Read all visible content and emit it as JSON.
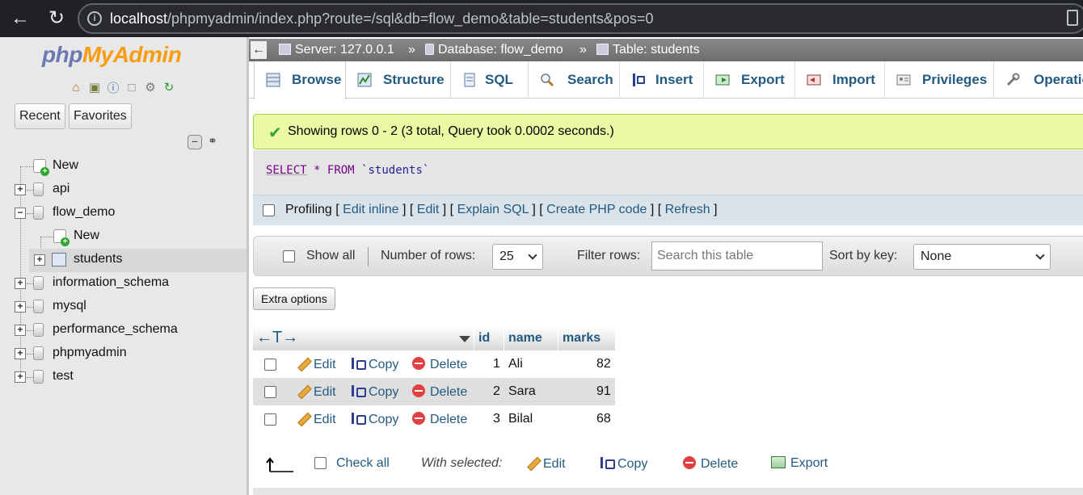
{
  "browser": {
    "url_host": "localhost",
    "url_path": "/phpmyadmin/index.php?route=/sql&db=flow_demo&table=students&pos=0"
  },
  "nav": {
    "logo_php": "php",
    "logo_myadmin": "MyAdmin",
    "recent_label": "Recent",
    "favorites_label": "Favorites",
    "tree": [
      {
        "label": "New",
        "type": "new",
        "level": 0
      },
      {
        "label": "api",
        "type": "db",
        "level": 0
      },
      {
        "label": "flow_demo",
        "type": "db",
        "level": 0,
        "expanded": true
      },
      {
        "label": "New",
        "type": "new",
        "level": 1
      },
      {
        "label": "students",
        "type": "table",
        "level": 1,
        "selected": true
      },
      {
        "label": "information_schema",
        "type": "db",
        "level": 0
      },
      {
        "label": "mysql",
        "type": "db",
        "level": 0
      },
      {
        "label": "performance_schema",
        "type": "db",
        "level": 0
      },
      {
        "label": "phpmyadmin",
        "type": "db",
        "level": 0
      },
      {
        "label": "test",
        "type": "db",
        "level": 0
      }
    ]
  },
  "breadcrumb": {
    "server": "Server: 127.0.0.1",
    "database": "Database: flow_demo",
    "table": "Table: students",
    "separator": "»"
  },
  "menu": {
    "browse": "Browse",
    "structure": "Structure",
    "sql": "SQL",
    "search": "Search",
    "insert": "Insert",
    "export": "Export",
    "import": "Import",
    "privileges": "Privileges",
    "operations": "Operations"
  },
  "result": {
    "message": "Showing rows 0 - 2 (3 total, Query took 0.0002 seconds.)",
    "sql_select": "SELECT",
    "sql_star": "*",
    "sql_from": "FROM",
    "sql_table": "`students`"
  },
  "profiling": {
    "label": "Profiling",
    "edit_inline": "Edit inline",
    "edit": "Edit",
    "explain_sql": "Explain SQL",
    "create_php": "Create PHP code",
    "refresh": "Refresh"
  },
  "navigation": {
    "show_all": "Show all",
    "number_of_rows_label": "Number of rows:",
    "number_of_rows_value": "25",
    "filter_rows_label": "Filter rows:",
    "filter_placeholder": "Search this table",
    "sort_by_key_label": "Sort by key:",
    "sort_by_key_value": "None"
  },
  "extra_options": "Extra options",
  "table": {
    "columns": [
      "id",
      "name",
      "marks"
    ],
    "action_edit": "Edit",
    "action_copy": "Copy",
    "action_delete": "Delete",
    "rows": [
      {
        "id": "1",
        "name": "Ali",
        "marks": "82"
      },
      {
        "id": "2",
        "name": "Sara",
        "marks": "91"
      },
      {
        "id": "3",
        "name": "Bilal",
        "marks": "68"
      }
    ]
  },
  "bulk": {
    "check_all": "Check all",
    "with_selected": "With selected:",
    "edit": "Edit",
    "copy": "Copy",
    "delete": "Delete",
    "export": "Export"
  },
  "colors": {
    "link": "#235a81",
    "success_bg": "#ebf8a4",
    "logo_php": "#6c78af",
    "logo_myadmin": "#f89c0e"
  }
}
